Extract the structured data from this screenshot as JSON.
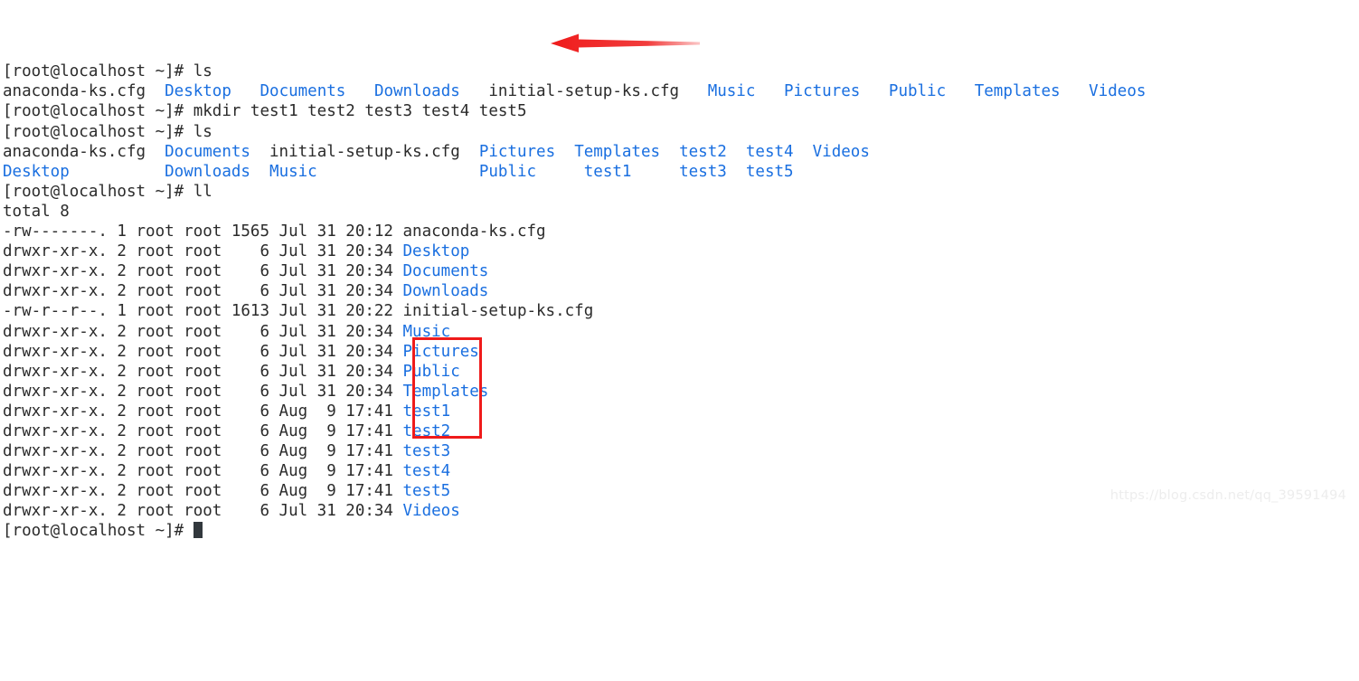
{
  "terminal": {
    "app": "bash-shell",
    "prompt": "[root@localhost ~]# ",
    "colors": {
      "background": "#ffffff",
      "foreground": "#2b2b2b",
      "directory": "#1a6fe0",
      "annotation_red": "#ef1b1b",
      "cursor": "#32383d",
      "watermark": "#ededed"
    },
    "lines": [
      {
        "id": "l01",
        "type": "prompt",
        "prompt": "[root@localhost ~]# ",
        "command": "ls"
      },
      {
        "id": "l02",
        "type": "output",
        "segments": [
          {
            "text": "anaconda-ks.cfg  ",
            "color": "plain"
          },
          {
            "text": "Desktop",
            "color": "dir"
          },
          {
            "text": "   ",
            "color": "plain"
          },
          {
            "text": "Documents",
            "color": "dir"
          },
          {
            "text": "   ",
            "color": "plain"
          },
          {
            "text": "Downloads",
            "color": "dir"
          },
          {
            "text": "   initial-setup-ks.cfg   ",
            "color": "plain"
          },
          {
            "text": "Music",
            "color": "dir"
          },
          {
            "text": "   ",
            "color": "plain"
          },
          {
            "text": "Pictures",
            "color": "dir"
          },
          {
            "text": "   ",
            "color": "plain"
          },
          {
            "text": "Public",
            "color": "dir"
          },
          {
            "text": "   ",
            "color": "plain"
          },
          {
            "text": "Templates",
            "color": "dir"
          },
          {
            "text": "   ",
            "color": "plain"
          },
          {
            "text": "Videos",
            "color": "dir"
          }
        ]
      },
      {
        "id": "l03",
        "type": "prompt",
        "prompt": "[root@localhost ~]# ",
        "command": "mkdir test1 test2 test3 test4 test5"
      },
      {
        "id": "l04",
        "type": "prompt",
        "prompt": "[root@localhost ~]# ",
        "command": "ls"
      },
      {
        "id": "l05",
        "type": "output",
        "segments": [
          {
            "text": "anaconda-ks.cfg  ",
            "color": "plain"
          },
          {
            "text": "Documents",
            "color": "dir"
          },
          {
            "text": "  initial-setup-ks.cfg  ",
            "color": "plain"
          },
          {
            "text": "Pictures",
            "color": "dir"
          },
          {
            "text": "  ",
            "color": "plain"
          },
          {
            "text": "Templates",
            "color": "dir"
          },
          {
            "text": "  ",
            "color": "plain"
          },
          {
            "text": "test2",
            "color": "dir"
          },
          {
            "text": "  ",
            "color": "plain"
          },
          {
            "text": "test4",
            "color": "dir"
          },
          {
            "text": "  ",
            "color": "plain"
          },
          {
            "text": "Videos",
            "color": "dir"
          }
        ]
      },
      {
        "id": "l06",
        "type": "output",
        "segments": [
          {
            "text": "Desktop",
            "color": "dir"
          },
          {
            "text": "          ",
            "color": "plain"
          },
          {
            "text": "Downloads",
            "color": "dir"
          },
          {
            "text": "  ",
            "color": "plain"
          },
          {
            "text": "Music",
            "color": "dir"
          },
          {
            "text": "                 ",
            "color": "plain"
          },
          {
            "text": "Public",
            "color": "dir"
          },
          {
            "text": "     ",
            "color": "plain"
          },
          {
            "text": "test1",
            "color": "dir"
          },
          {
            "text": "     ",
            "color": "plain"
          },
          {
            "text": "test3",
            "color": "dir"
          },
          {
            "text": "  ",
            "color": "plain"
          },
          {
            "text": "test5",
            "color": "dir"
          }
        ]
      },
      {
        "id": "l07",
        "type": "prompt",
        "prompt": "[root@localhost ~]# ",
        "command": "ll"
      },
      {
        "id": "l08",
        "type": "output",
        "segments": [
          {
            "text": "total 8",
            "color": "plain"
          }
        ]
      },
      {
        "id": "l09",
        "type": "listing",
        "segments": [
          {
            "text": "-rw-------. 1 root root 1565 Jul 31 20:12 anaconda-ks.cfg",
            "color": "plain"
          }
        ]
      },
      {
        "id": "l10",
        "type": "listing",
        "segments": [
          {
            "text": "drwxr-xr-x. 2 root root    6 Jul 31 20:34 ",
            "color": "plain"
          },
          {
            "text": "Desktop",
            "color": "dir"
          }
        ]
      },
      {
        "id": "l11",
        "type": "listing",
        "segments": [
          {
            "text": "drwxr-xr-x. 2 root root    6 Jul 31 20:34 ",
            "color": "plain"
          },
          {
            "text": "Documents",
            "color": "dir"
          }
        ]
      },
      {
        "id": "l12",
        "type": "listing",
        "segments": [
          {
            "text": "drwxr-xr-x. 2 root root    6 Jul 31 20:34 ",
            "color": "plain"
          },
          {
            "text": "Downloads",
            "color": "dir"
          }
        ]
      },
      {
        "id": "l13",
        "type": "listing",
        "segments": [
          {
            "text": "-rw-r--r--. 1 root root 1613 Jul 31 20:22 initial-setup-ks.cfg",
            "color": "plain"
          }
        ]
      },
      {
        "id": "l14",
        "type": "listing",
        "segments": [
          {
            "text": "drwxr-xr-x. 2 root root    6 Jul 31 20:34 ",
            "color": "plain"
          },
          {
            "text": "Music",
            "color": "dir"
          }
        ]
      },
      {
        "id": "l15",
        "type": "listing",
        "segments": [
          {
            "text": "drwxr-xr-x. 2 root root    6 Jul 31 20:34 ",
            "color": "plain"
          },
          {
            "text": "Pictures",
            "color": "dir"
          }
        ]
      },
      {
        "id": "l16",
        "type": "listing",
        "segments": [
          {
            "text": "drwxr-xr-x. 2 root root    6 Jul 31 20:34 ",
            "color": "plain"
          },
          {
            "text": "Public",
            "color": "dir"
          }
        ]
      },
      {
        "id": "l17",
        "type": "listing",
        "segments": [
          {
            "text": "drwxr-xr-x. 2 root root    6 Jul 31 20:34 ",
            "color": "plain"
          },
          {
            "text": "Templates",
            "color": "dir"
          }
        ]
      },
      {
        "id": "l18",
        "type": "listing",
        "segments": [
          {
            "text": "drwxr-xr-x. 2 root root    6 Aug  9 17:41 ",
            "color": "plain"
          },
          {
            "text": "test1",
            "color": "dir"
          }
        ]
      },
      {
        "id": "l19",
        "type": "listing",
        "segments": [
          {
            "text": "drwxr-xr-x. 2 root root    6 Aug  9 17:41 ",
            "color": "plain"
          },
          {
            "text": "test2",
            "color": "dir"
          }
        ]
      },
      {
        "id": "l20",
        "type": "listing",
        "segments": [
          {
            "text": "drwxr-xr-x. 2 root root    6 Aug  9 17:41 ",
            "color": "plain"
          },
          {
            "text": "test3",
            "color": "dir"
          }
        ]
      },
      {
        "id": "l21",
        "type": "listing",
        "segments": [
          {
            "text": "drwxr-xr-x. 2 root root    6 Aug  9 17:41 ",
            "color": "plain"
          },
          {
            "text": "test4",
            "color": "dir"
          }
        ]
      },
      {
        "id": "l22",
        "type": "listing",
        "segments": [
          {
            "text": "drwxr-xr-x. 2 root root    6 Aug  9 17:41 ",
            "color": "plain"
          },
          {
            "text": "test5",
            "color": "dir"
          }
        ]
      },
      {
        "id": "l23",
        "type": "listing",
        "segments": [
          {
            "text": "drwxr-xr-x. 2 root root    6 Jul 31 20:34 ",
            "color": "plain"
          },
          {
            "text": "Videos",
            "color": "dir"
          }
        ]
      },
      {
        "id": "l24",
        "type": "prompt-cursor",
        "prompt": "[root@localhost ~]# ",
        "command": ""
      }
    ]
  },
  "annotations": {
    "red_box": {
      "label": "highlight-test-dirs",
      "targets": [
        "test1",
        "test2",
        "test3",
        "test4",
        "test5"
      ]
    },
    "red_arrow": {
      "label": "points-to-mkdir-command",
      "direction": "left",
      "target": "test5"
    }
  },
  "watermark": {
    "text": "https://blog.csdn.net/qq_39591494"
  }
}
